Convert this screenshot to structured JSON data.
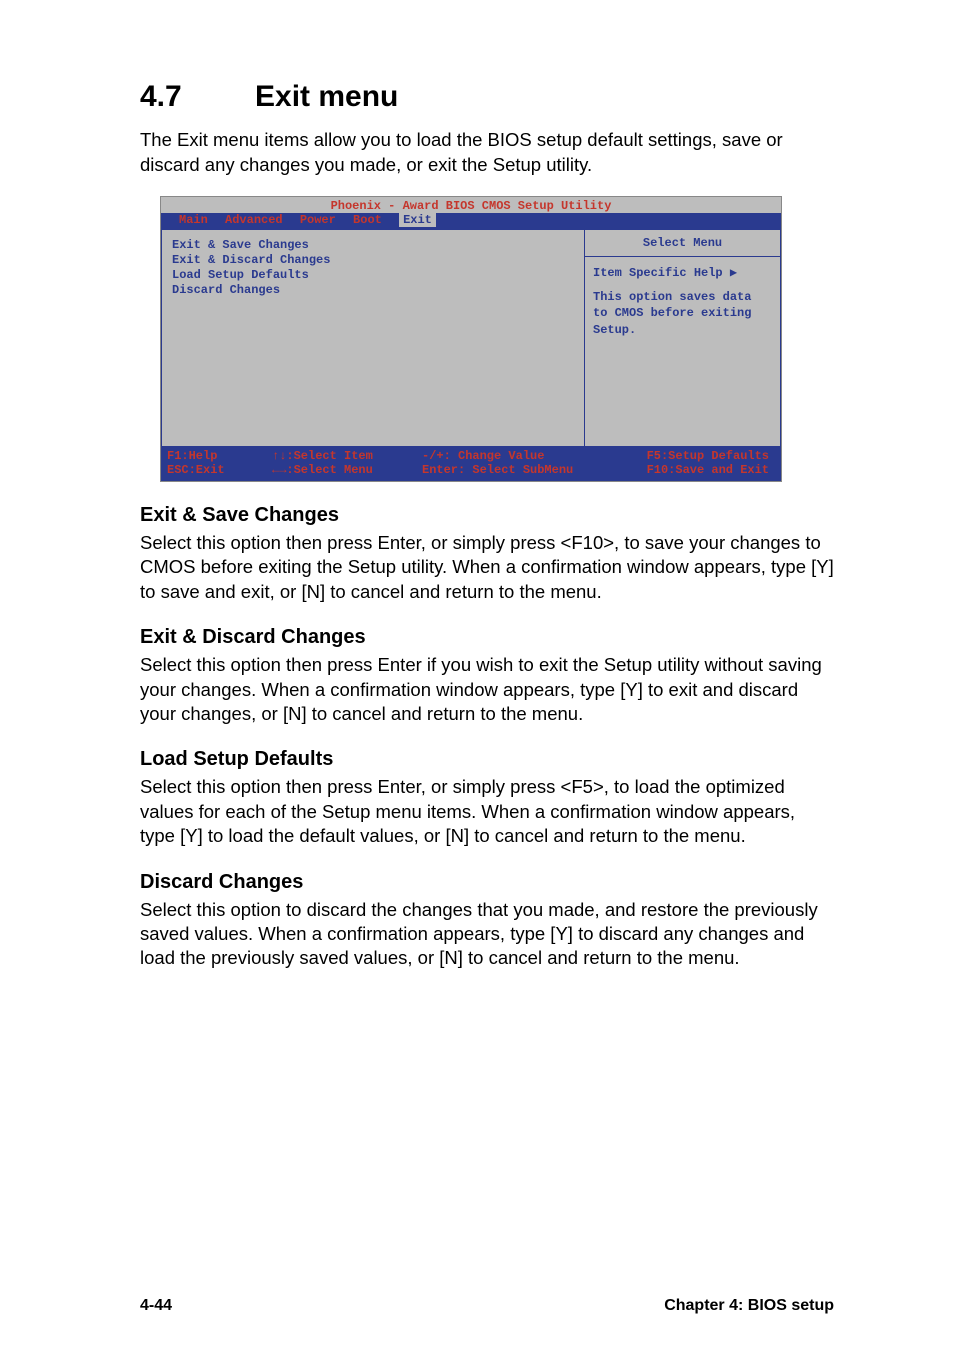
{
  "heading": {
    "number": "4.7",
    "title": "Exit menu"
  },
  "intro": "The Exit menu items allow you to load the BIOS setup default settings, save or discard any changes you made, or exit the Setup utility.",
  "bios": {
    "title": "Phoenix - Award BIOS CMOS Setup Utility",
    "tabs": [
      "Main",
      "Advanced",
      "Power",
      "Boot",
      "Exit"
    ],
    "active_tab": "Exit",
    "menu_items": [
      "Exit & Save Changes",
      "Exit & Discard Changes",
      "Load Setup Defaults",
      "Discard Changes"
    ],
    "help": {
      "title": "Select Menu",
      "item_specific": "Item Specific Help",
      "text": "This option saves data to CMOS before exiting Setup."
    },
    "footer": {
      "row1": {
        "c1": "F1:Help",
        "c2": "↑↓:Select Item",
        "c3": "-/+: Change Value",
        "c4": "F5:Setup Defaults"
      },
      "row2": {
        "c1": "ESC:Exit",
        "c2": "←→:Select Menu",
        "c3": "Enter: Select SubMenu",
        "c4": "F10:Save and Exit"
      }
    }
  },
  "sections": [
    {
      "title": "Exit & Save Changes",
      "body": "Select this option then press Enter, or simply press <F10>, to save your changes to CMOS before exiting the Setup utility. When a confirmation window appears, type [Y] to save and exit, or [N] to cancel and return to the menu."
    },
    {
      "title": "Exit & Discard Changes",
      "body": "Select this option then press Enter if you wish to exit the Setup utility without saving your changes. When a confirmation window appears, type [Y] to exit and discard your changes, or [N] to cancel and return to the menu."
    },
    {
      "title": "Load Setup Defaults",
      "body": "Select this option then press Enter, or simply press <F5>, to load the optimized values for each of the Setup menu items. When a confirmation window appears, type [Y] to load the default values, or [N] to cancel and return to the menu."
    },
    {
      "title": "Discard Changes",
      "body": "Select this option to discard the changes that you made, and restore the previously saved values. When a confirmation appears, type [Y] to discard any changes and load the previously saved values, or [N] to cancel and return to the menu."
    }
  ],
  "footer": {
    "left": "4-44",
    "right": "Chapter 4: BIOS setup"
  }
}
